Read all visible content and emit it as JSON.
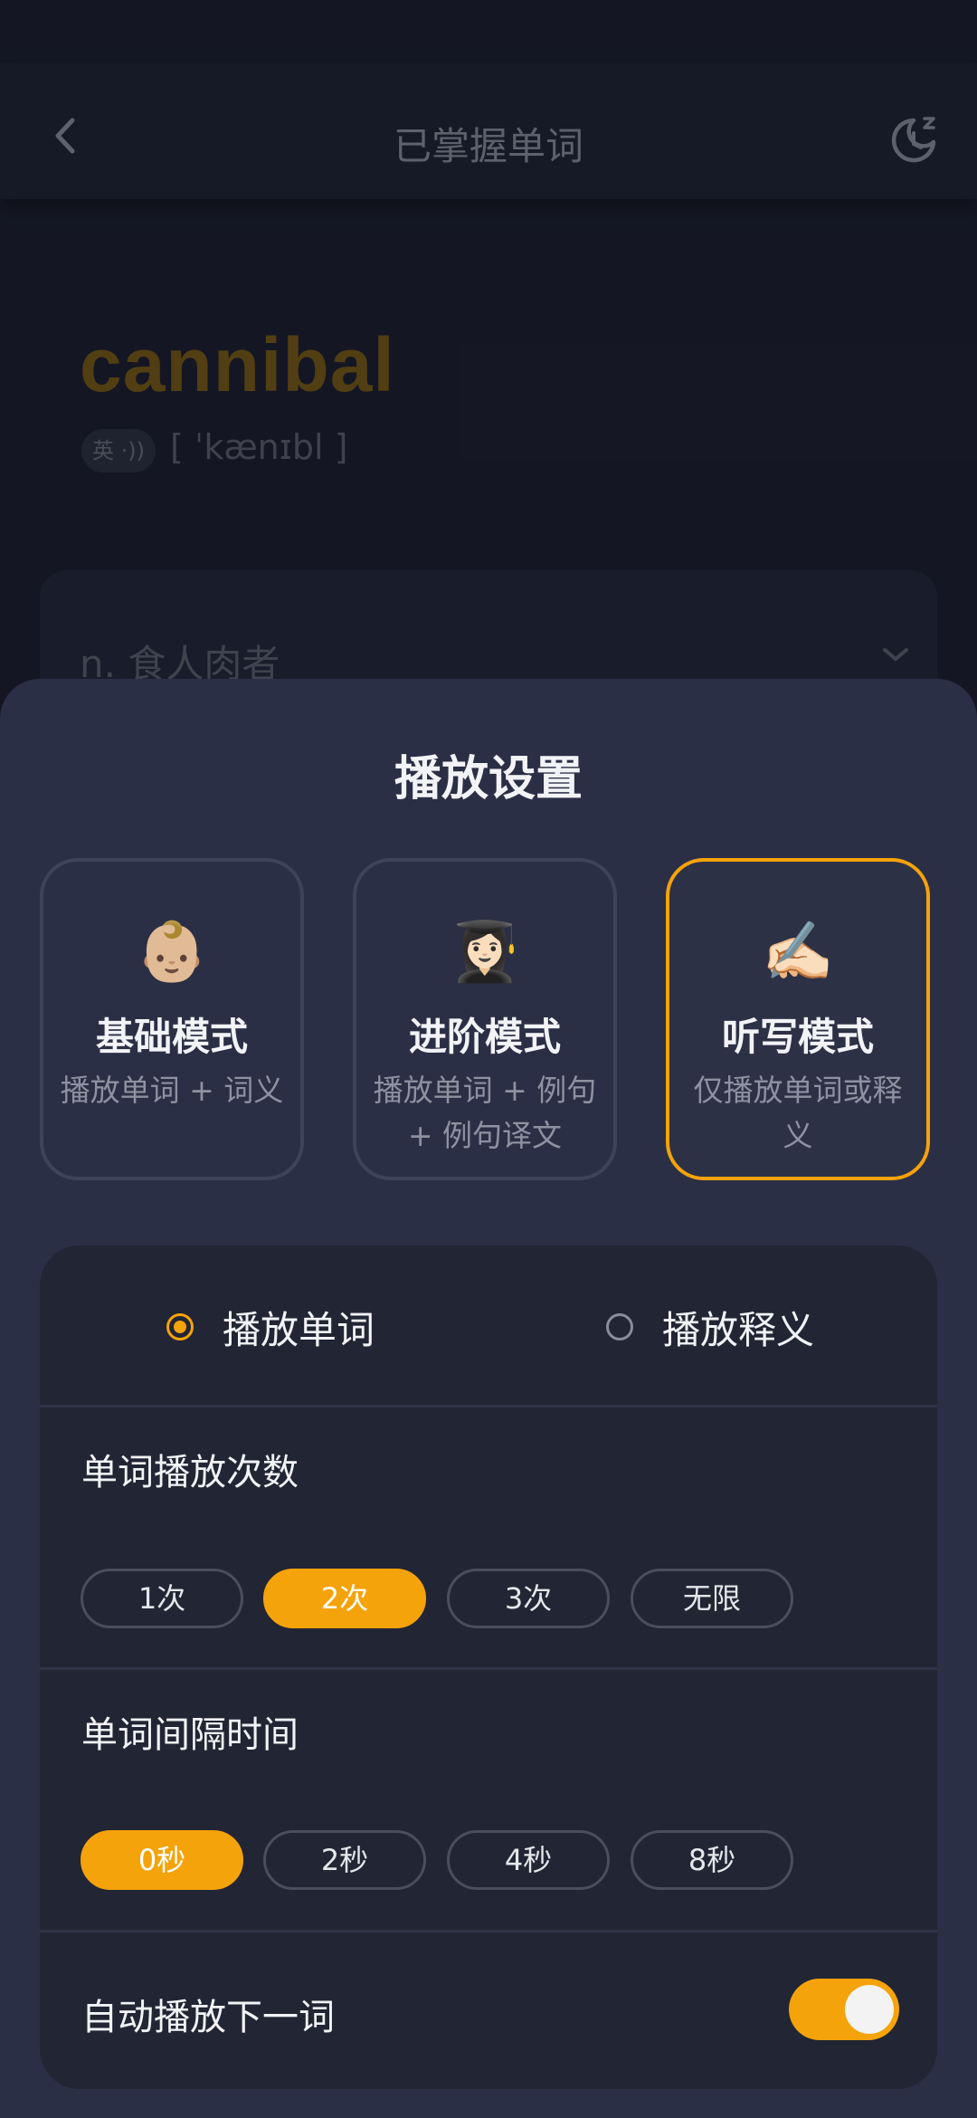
{
  "header": {
    "title": "已掌握单词"
  },
  "word": {
    "text": "cannibal",
    "accent": "英 ·))",
    "phonetic": "[ ˈkænɪbl ]",
    "definition": "n. 食人肉者"
  },
  "sheet": {
    "title": "播放设置",
    "modes": [
      {
        "emoji": "👶🏼",
        "name": "基础模式",
        "desc": "播放单词 + 词义",
        "selected": false
      },
      {
        "emoji": "👩🏻‍🎓",
        "name": "进阶模式",
        "desc": "播放单词 + 例句 + 例句译文",
        "selected": false
      },
      {
        "emoji": "✍🏻",
        "name": "听写模式",
        "desc": "仅播放单词或释义",
        "selected": true
      }
    ],
    "play_target": {
      "options": [
        "播放单词",
        "播放释义"
      ],
      "selected": "播放单词"
    },
    "repeat": {
      "label": "单词播放次数",
      "options": [
        "1次",
        "2次",
        "3次",
        "无限"
      ],
      "selected": "2次"
    },
    "interval": {
      "label": "单词间隔时间",
      "options": [
        "0秒",
        "2秒",
        "4秒",
        "8秒"
      ],
      "selected": "0秒"
    },
    "autoplay": {
      "label": "自动播放下一词",
      "enabled": true
    }
  },
  "colors": {
    "accent": "#f5a30a",
    "sheet_bg": "#2b2f45",
    "card_bg": "#222533"
  }
}
